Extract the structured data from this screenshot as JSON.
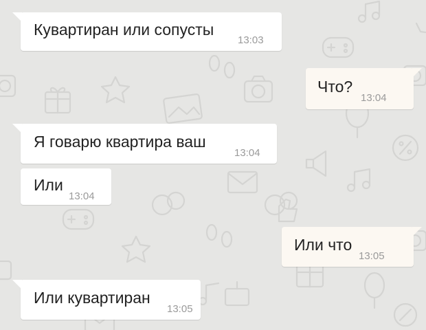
{
  "colors": {
    "wallpaper": "#e6e6e4",
    "incoming_bubble": "#ffffff",
    "outgoing_bubble": "#fcf8f2",
    "text": "#222222",
    "time": "#9a9a9a"
  },
  "wallpaper_icons": [
    "music-note-icon",
    "gamepad-icon",
    "camera-icon",
    "gift-icon",
    "picture-icon",
    "star-icon",
    "footprints-icon",
    "balloon-icon",
    "megaphone-icon",
    "envelope-icon",
    "chat-bubbles-icon",
    "percent-tag-icon",
    "thumbs-up-icon",
    "cake-icon"
  ],
  "messages": [
    {
      "direction": "incoming",
      "text": "Кувартиран или сопусты",
      "time": "13:03"
    },
    {
      "direction": "outgoing",
      "text": "Что?",
      "time": "13:04"
    },
    {
      "direction": "incoming",
      "text": "Я говарю квартира ваш",
      "time": "13:04"
    },
    {
      "direction": "incoming",
      "text": "Или",
      "time": "13:04"
    },
    {
      "direction": "outgoing",
      "text": "Или что",
      "time": "13:05"
    },
    {
      "direction": "incoming",
      "text": "Или кувартиран",
      "time": "13:05"
    }
  ]
}
